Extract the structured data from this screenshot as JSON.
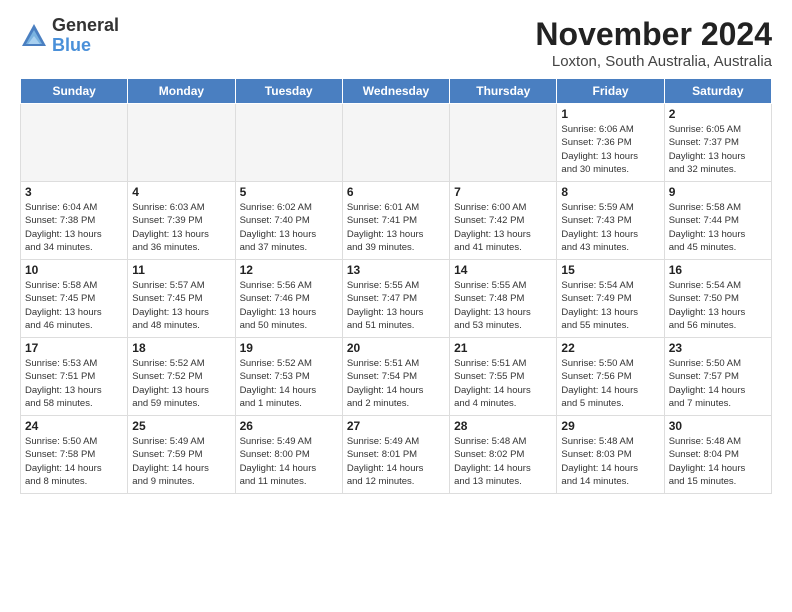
{
  "logo": {
    "general": "General",
    "blue": "Blue"
  },
  "title": "November 2024",
  "location": "Loxton, South Australia, Australia",
  "headers": [
    "Sunday",
    "Monday",
    "Tuesday",
    "Wednesday",
    "Thursday",
    "Friday",
    "Saturday"
  ],
  "weeks": [
    [
      {
        "day": "",
        "info": "",
        "empty": true
      },
      {
        "day": "",
        "info": "",
        "empty": true
      },
      {
        "day": "",
        "info": "",
        "empty": true
      },
      {
        "day": "",
        "info": "",
        "empty": true
      },
      {
        "day": "",
        "info": "",
        "empty": true
      },
      {
        "day": "1",
        "info": "Sunrise: 6:06 AM\nSunset: 7:36 PM\nDaylight: 13 hours\nand 30 minutes."
      },
      {
        "day": "2",
        "info": "Sunrise: 6:05 AM\nSunset: 7:37 PM\nDaylight: 13 hours\nand 32 minutes."
      }
    ],
    [
      {
        "day": "3",
        "info": "Sunrise: 6:04 AM\nSunset: 7:38 PM\nDaylight: 13 hours\nand 34 minutes."
      },
      {
        "day": "4",
        "info": "Sunrise: 6:03 AM\nSunset: 7:39 PM\nDaylight: 13 hours\nand 36 minutes."
      },
      {
        "day": "5",
        "info": "Sunrise: 6:02 AM\nSunset: 7:40 PM\nDaylight: 13 hours\nand 37 minutes."
      },
      {
        "day": "6",
        "info": "Sunrise: 6:01 AM\nSunset: 7:41 PM\nDaylight: 13 hours\nand 39 minutes."
      },
      {
        "day": "7",
        "info": "Sunrise: 6:00 AM\nSunset: 7:42 PM\nDaylight: 13 hours\nand 41 minutes."
      },
      {
        "day": "8",
        "info": "Sunrise: 5:59 AM\nSunset: 7:43 PM\nDaylight: 13 hours\nand 43 minutes."
      },
      {
        "day": "9",
        "info": "Sunrise: 5:58 AM\nSunset: 7:44 PM\nDaylight: 13 hours\nand 45 minutes."
      }
    ],
    [
      {
        "day": "10",
        "info": "Sunrise: 5:58 AM\nSunset: 7:45 PM\nDaylight: 13 hours\nand 46 minutes."
      },
      {
        "day": "11",
        "info": "Sunrise: 5:57 AM\nSunset: 7:45 PM\nDaylight: 13 hours\nand 48 minutes."
      },
      {
        "day": "12",
        "info": "Sunrise: 5:56 AM\nSunset: 7:46 PM\nDaylight: 13 hours\nand 50 minutes."
      },
      {
        "day": "13",
        "info": "Sunrise: 5:55 AM\nSunset: 7:47 PM\nDaylight: 13 hours\nand 51 minutes."
      },
      {
        "day": "14",
        "info": "Sunrise: 5:55 AM\nSunset: 7:48 PM\nDaylight: 13 hours\nand 53 minutes."
      },
      {
        "day": "15",
        "info": "Sunrise: 5:54 AM\nSunset: 7:49 PM\nDaylight: 13 hours\nand 55 minutes."
      },
      {
        "day": "16",
        "info": "Sunrise: 5:54 AM\nSunset: 7:50 PM\nDaylight: 13 hours\nand 56 minutes."
      }
    ],
    [
      {
        "day": "17",
        "info": "Sunrise: 5:53 AM\nSunset: 7:51 PM\nDaylight: 13 hours\nand 58 minutes."
      },
      {
        "day": "18",
        "info": "Sunrise: 5:52 AM\nSunset: 7:52 PM\nDaylight: 13 hours\nand 59 minutes."
      },
      {
        "day": "19",
        "info": "Sunrise: 5:52 AM\nSunset: 7:53 PM\nDaylight: 14 hours\nand 1 minutes."
      },
      {
        "day": "20",
        "info": "Sunrise: 5:51 AM\nSunset: 7:54 PM\nDaylight: 14 hours\nand 2 minutes."
      },
      {
        "day": "21",
        "info": "Sunrise: 5:51 AM\nSunset: 7:55 PM\nDaylight: 14 hours\nand 4 minutes."
      },
      {
        "day": "22",
        "info": "Sunrise: 5:50 AM\nSunset: 7:56 PM\nDaylight: 14 hours\nand 5 minutes."
      },
      {
        "day": "23",
        "info": "Sunrise: 5:50 AM\nSunset: 7:57 PM\nDaylight: 14 hours\nand 7 minutes."
      }
    ],
    [
      {
        "day": "24",
        "info": "Sunrise: 5:50 AM\nSunset: 7:58 PM\nDaylight: 14 hours\nand 8 minutes."
      },
      {
        "day": "25",
        "info": "Sunrise: 5:49 AM\nSunset: 7:59 PM\nDaylight: 14 hours\nand 9 minutes."
      },
      {
        "day": "26",
        "info": "Sunrise: 5:49 AM\nSunset: 8:00 PM\nDaylight: 14 hours\nand 11 minutes."
      },
      {
        "day": "27",
        "info": "Sunrise: 5:49 AM\nSunset: 8:01 PM\nDaylight: 14 hours\nand 12 minutes."
      },
      {
        "day": "28",
        "info": "Sunrise: 5:48 AM\nSunset: 8:02 PM\nDaylight: 14 hours\nand 13 minutes."
      },
      {
        "day": "29",
        "info": "Sunrise: 5:48 AM\nSunset: 8:03 PM\nDaylight: 14 hours\nand 14 minutes."
      },
      {
        "day": "30",
        "info": "Sunrise: 5:48 AM\nSunset: 8:04 PM\nDaylight: 14 hours\nand 15 minutes."
      }
    ]
  ]
}
